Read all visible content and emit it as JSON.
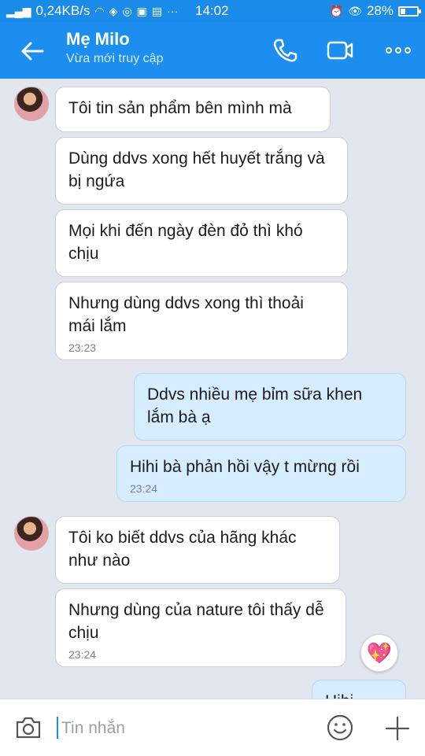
{
  "status_bar": {
    "network_speed": "0,24KB/s",
    "time": "14:02",
    "battery_percent": "28%",
    "battery_level": 0.28
  },
  "header": {
    "title": "Mẹ Milo",
    "subtitle": "Vừa mới truy cập"
  },
  "messages": [
    {
      "text": "Tôi tin sản phẩm bên mình mà",
      "time": ""
    },
    {
      "text": "Dùng ddvs xong hết huyết trắng và bị ngứa",
      "time": ""
    },
    {
      "text": "Mọi khi đến ngày đèn đỏ thì khó chịu",
      "time": ""
    },
    {
      "text": "Nhưng dùng ddvs xong thì thoải mái lắm",
      "time": "23:23"
    },
    {
      "text": "Ddvs nhiều mẹ bỉm sữa khen lắm bà ạ",
      "time": ""
    },
    {
      "text": "Hihi bà phản hồi vậy t mừng rồi",
      "time": "23:24"
    },
    {
      "text": "Tôi ko biết ddvs của hãng khác như nào",
      "time": ""
    },
    {
      "text": "Nhưng dùng của nature tôi thấy dễ chịu",
      "time": "23:24"
    },
    {
      "text": "Hihi",
      "time": ""
    }
  ],
  "reaction": {
    "icon": "sparkling-heart-icon",
    "glyph": "💖"
  },
  "input": {
    "placeholder": "Tin nhắn"
  },
  "colors": {
    "header": "#1b8ef0",
    "bubble_mine": "#d6ecff",
    "bubble_theirs": "#ffffff"
  }
}
